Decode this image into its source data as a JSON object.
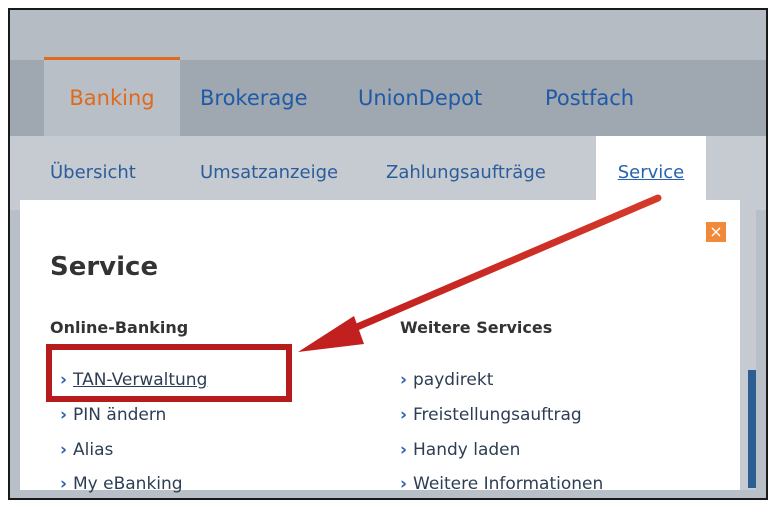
{
  "main_nav": {
    "tabs": [
      {
        "label": "Banking",
        "active": true
      },
      {
        "label": "Brokerage",
        "active": false
      },
      {
        "label": "UnionDepot",
        "active": false
      },
      {
        "label": "Postfach",
        "active": false
      }
    ]
  },
  "sub_nav": {
    "tabs": [
      {
        "label": "Übersicht",
        "active": false
      },
      {
        "label": "Umsatzanzeige",
        "active": false
      },
      {
        "label": "Zahlungsaufträge",
        "active": false
      },
      {
        "label": "Service",
        "active": true
      }
    ]
  },
  "panel": {
    "title": "Service",
    "close_symbol": "×",
    "columns": [
      {
        "heading": "Online-Banking",
        "links": [
          "TAN-Verwaltung",
          "PIN ändern",
          "Alias",
          "My eBanking"
        ]
      },
      {
        "heading": "Weitere Services",
        "links": [
          "paydirekt",
          "Freistellungsauftrag",
          "Handy laden",
          "Weitere Informationen"
        ]
      }
    ]
  },
  "colors": {
    "active_tab": "#e06a1c",
    "link_blue": "#2563b0",
    "annotation_red": "#b71c1c"
  },
  "icons": {
    "link_bullet": "chevron-right-icon",
    "close": "close-icon"
  }
}
